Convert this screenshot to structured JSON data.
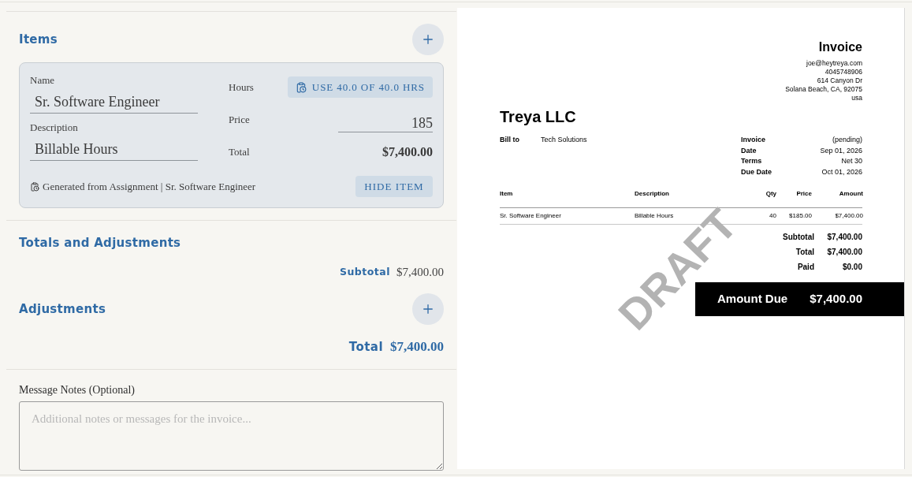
{
  "editor": {
    "items_title": "Items",
    "items": [
      {
        "name_label": "Name",
        "name_value": "Sr. Software Engineer",
        "description_label": "Description",
        "description_value": "Billable Hours",
        "hours_label": "Hours",
        "hours_button": "USE 40.0 OF 40.0 HRS",
        "price_label": "Price",
        "price_value": "185",
        "total_label": "Total",
        "total_value": "$7,400.00",
        "source_note": "Generated from Assignment | Sr. Software Engineer",
        "hide_button": "HIDE ITEM"
      }
    ],
    "totals": {
      "title": "Totals and Adjustments",
      "subtotal_label": "Subtotal",
      "subtotal_value": "$7,400.00"
    },
    "adjustments": {
      "title": "Adjustments",
      "total_label": "Total",
      "total_value": "$7,400.00"
    },
    "notes": {
      "label": "Message Notes (Optional)",
      "placeholder": "Additional notes or messages for the invoice..."
    }
  },
  "preview": {
    "title": "Invoice",
    "sender_contact": [
      "joe@heytreya.com",
      "4045748906",
      "614 Canyon Dr",
      "Solana Beach, CA, 92075",
      "usa"
    ],
    "company": "Treya LLC",
    "bill_to_label": "Bill to",
    "bill_to_value": "Tech Solutions",
    "meta": [
      {
        "label": "Invoice",
        "value": "(pending)"
      },
      {
        "label": "Date",
        "value": "Sep 01, 2026"
      },
      {
        "label": "Terms",
        "value": "Net 30"
      },
      {
        "label": "Due Date",
        "value": "Oct 01, 2026"
      }
    ],
    "table": {
      "columns": [
        "Item",
        "Description",
        "Qty",
        "Price",
        "Amount"
      ],
      "rows": [
        [
          "Sr. Software Engineer",
          "Billable Hours",
          "40",
          "$185.00",
          "$7,400.00"
        ]
      ]
    },
    "summary": [
      {
        "label": "Subtotal",
        "value": "$7,400.00"
      },
      {
        "label": "Total",
        "value": "$7,400.00"
      },
      {
        "label": "Paid",
        "value": "$0.00"
      }
    ],
    "amount_due": {
      "label": "Amount Due",
      "value": "$7,400.00"
    },
    "stamp": "DRAFT"
  }
}
